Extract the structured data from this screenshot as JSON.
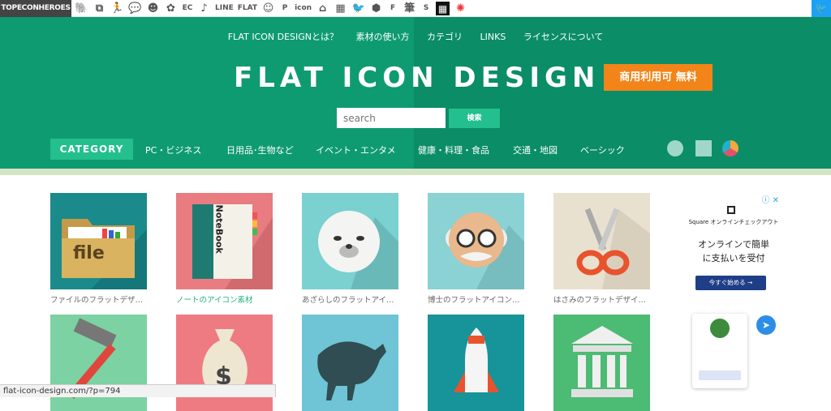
{
  "topbar": {
    "brand": "TOPECONHEROES",
    "icons": [
      "animal-icon",
      "copy-icon",
      "person-icon",
      "chat-icon",
      "face-icon",
      "flower-icon",
      "EC",
      "note-icon",
      "LINE",
      "FLAT",
      "smile-icon",
      "P",
      "icon",
      "house-icon",
      "building-icon",
      "bird-icon",
      "hex-icon",
      "F",
      "brush-icon",
      "S",
      "grid-icon",
      "burst-icon"
    ],
    "twitter": "twitter-icon"
  },
  "nav": [
    "FLAT ICON DESIGNとは？",
    "素材の使い方",
    "カテゴリ",
    "LINKS",
    "ライセンスについて"
  ],
  "logo": "FLAT ICON DESIGN",
  "badge": "商用利用可 無料",
  "search": {
    "placeholder": "search",
    "button": "検索"
  },
  "categories": {
    "label": "CATEGORY",
    "items": [
      "PC・ビジネス",
      "日用品･生物など",
      "イベント・エンタメ",
      "健康・料理・食品",
      "交通・地図",
      "ベーシック"
    ]
  },
  "colors": {
    "hero": "#0f9b72",
    "accent": "#23bf8d",
    "badge": "#f28419"
  },
  "cards": [
    {
      "caption": "ファイルのフラットデザ…",
      "label": "file",
      "bg": "#1b8a8b"
    },
    {
      "caption": "ノートのアイコン素材",
      "label": "NoteBook",
      "bg": "#e87c80"
    },
    {
      "caption": "あざらしのフラットアイ…",
      "bg": "#7bd0d0"
    },
    {
      "caption": "博士のフラットアイコン…",
      "bg": "#8ad2d4"
    },
    {
      "caption": "はさみのフラットデザイ…",
      "bg": "#e9e1cf"
    },
    {
      "caption": "",
      "bg": "#7cd2a2"
    },
    {
      "caption": "",
      "bg": "#ef7b82"
    },
    {
      "caption": "",
      "bg": "#6fc4d5"
    },
    {
      "caption": "",
      "bg": "#17939a"
    },
    {
      "caption": "",
      "bg": "#4cbb73"
    }
  ],
  "ad": {
    "brand": "Square オンラインチェックアウト",
    "text1": "オンラインで簡単",
    "text2": "に支払いを受付",
    "button": "今すぐ始める →"
  },
  "status": "flat-icon-design.com/?p=794"
}
